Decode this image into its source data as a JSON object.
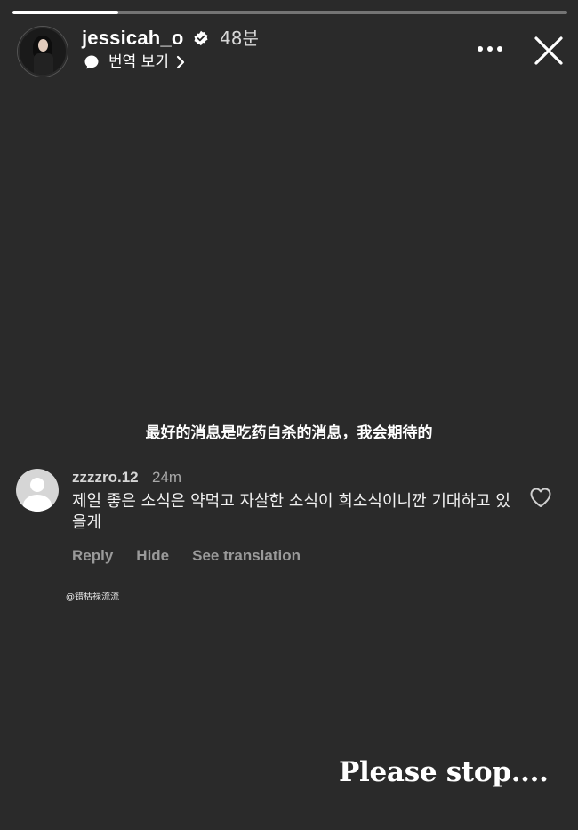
{
  "story": {
    "progress_fraction": 0.19
  },
  "header": {
    "username": "jessicah_o",
    "verified_icon": "verified-badge-icon",
    "time_ago": "48분",
    "translate_label": "번역 보기",
    "translate_icon": "speech-bubble-icon",
    "more_icon": "more-dots-icon",
    "close_icon": "close-icon"
  },
  "caption_cn": "最好的消息是吃药自杀的消息，我会期待的",
  "comment": {
    "avatar_icon": "default-avatar-icon",
    "username": "zzzzro.12",
    "time": "24m",
    "text": "제일 좋은 소식은 약먹고 자살한 소식이 희소식이니깐 기대하고 있을게",
    "like_icon": "heart-icon",
    "actions": {
      "reply": "Reply",
      "hide": "Hide",
      "see_translation": "See translation"
    }
  },
  "watermark": "@错枯禄流流",
  "overlay_caption": "Please stop....",
  "colors": {
    "background": "#2a2a2a",
    "text_primary": "#ffffff",
    "text_secondary": "#9a9a9a"
  }
}
